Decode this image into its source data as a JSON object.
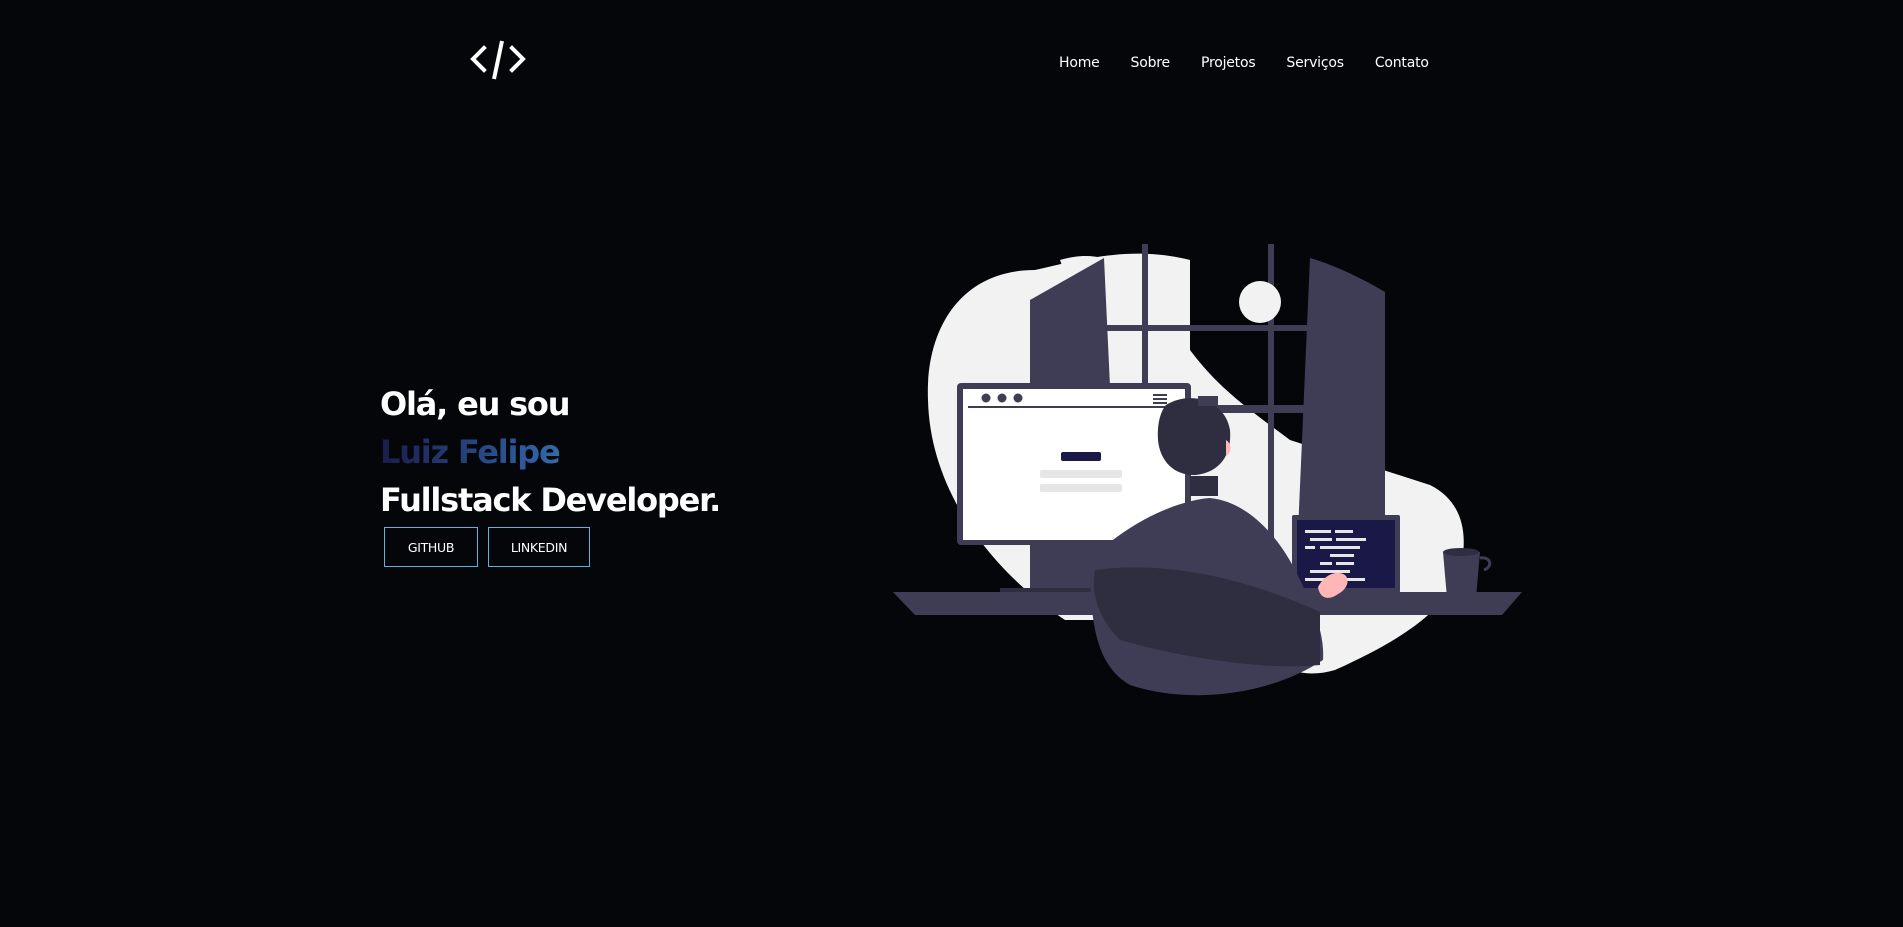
{
  "header": {
    "logo_icon": "code-brackets-icon",
    "nav": [
      {
        "label": "Home"
      },
      {
        "label": "Sobre"
      },
      {
        "label": "Projetos"
      },
      {
        "label": "Serviços"
      },
      {
        "label": "Contato"
      }
    ]
  },
  "hero": {
    "greeting": "Olá, eu sou",
    "name": "Luiz Felipe",
    "role": "Fullstack Developer.",
    "buttons": {
      "github": "GITHUB",
      "linkedin": "LINKEDIN"
    }
  },
  "colors": {
    "background": "#05060a",
    "button_border": "#5fb3d6",
    "gradient_start": "#1b1c4a",
    "gradient_mid": "#2f5da0",
    "gradient_end": "#47c9c4",
    "illustration_dark": "#3f3d56",
    "illustration_light": "#f2f2f2"
  },
  "illustration": {
    "icon": "developer-at-desk-illustration"
  }
}
